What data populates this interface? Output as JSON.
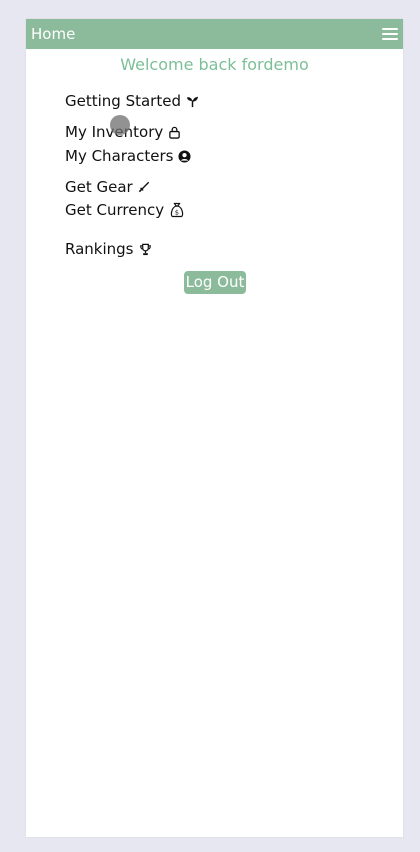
{
  "header": {
    "title": "Home"
  },
  "welcome": "Welcome back fordemo",
  "nav": {
    "getting_started": "Getting Started",
    "my_inventory": "My Inventory",
    "my_characters": "My Characters",
    "get_gear": "Get Gear",
    "get_currency": "Get Currency",
    "rankings": "Rankings"
  },
  "logout_label": "Log Out",
  "icons": {
    "menu": "hamburger-menu-icon",
    "getting_started": "sprout-icon",
    "my_inventory": "bag-icon",
    "my_characters": "user-circle-icon",
    "get_gear": "sword-icon",
    "get_currency": "money-bag-icon",
    "rankings": "trophy-icon"
  },
  "colors": {
    "accent": "#8cbb9c",
    "welcome_text": "#7cbf97",
    "background": "#e6e7f1"
  }
}
